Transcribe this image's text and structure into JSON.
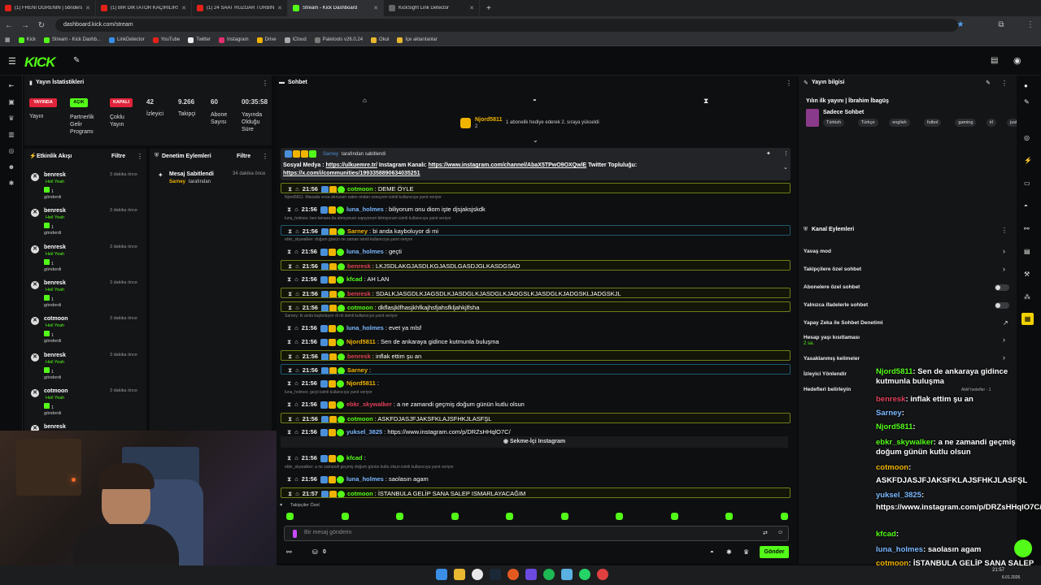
{
  "browser": {
    "tabs": [
      {
        "title": "(1) FRENİ ÖĞRENİN | 5briders",
        "color": "#e62117"
      },
      {
        "title": "(1) BİR DİKTATÖR KAÇIRILIRSA",
        "color": "#e62117"
      },
      {
        "title": "(1) 24 SAAT RÜZGAR TÜRBİNİ",
        "color": "#e62117"
      },
      {
        "title": "Stream - Kick Dashboard",
        "color": "#53fc18"
      },
      {
        "title": "KickSight Link Detector",
        "color": "#666666"
      }
    ],
    "url": "dashboard.kick.com/stream",
    "bookmarks": [
      "Kick",
      "Stream - Kick Dashb...",
      "LinkDetector",
      "YouTube",
      "Twitter",
      "Instagram",
      "Drive",
      "iCloud",
      "Paletools v26.0.24",
      "Okul",
      "İçe aktarılanlar"
    ]
  },
  "kick": {
    "logo": "KICK",
    "beta": "BETA"
  },
  "stats": {
    "title": "Yayın İstatistikleri",
    "badges": {
      "live": "YAYINDA",
      "open": "AÇIK",
      "closed": "KAPALI"
    },
    "labels": {
      "stream": "Yayın",
      "partner": "Partnerlik Gelir Programı",
      "multi": "Çoklu Yayın"
    },
    "viewers": "42",
    "viewers_label": "İzleyici",
    "followers": "9.266",
    "followers_label": "Takipçi",
    "subs": "60",
    "subs_label": "Abone Sayısı",
    "uptime": "00:35:58",
    "uptime_label": "Yayında Olduğu Süre"
  },
  "activity": {
    "title": "Etkinlik Akışı",
    "filter": "Filtre",
    "sub_text": "Heil Yeah",
    "count_text": "1",
    "count_label": "gönderdi",
    "items": [
      {
        "name": "benresk",
        "time": "3 dakika önce"
      },
      {
        "name": "benresk",
        "time": "3 dakika önce"
      },
      {
        "name": "benresk",
        "time": "3 dakika önce"
      },
      {
        "name": "benresk",
        "time": "3 dakika önce"
      },
      {
        "name": "cotmoon",
        "time": "3 dakika önce"
      },
      {
        "name": "benresk",
        "time": "3 dakika önce"
      },
      {
        "name": "cotmoon",
        "time": "3 dakika önce"
      },
      {
        "name": "benresk",
        "time": ""
      }
    ]
  },
  "moderation": {
    "title": "Denetim Eylemleri",
    "filter": "Filtre",
    "item_title": "Mesaj Sabitlendi",
    "item_time": "34 dakika önce",
    "item_user": "Sarney",
    "item_suffix": "tarafından"
  },
  "chat": {
    "title": "Sohbet",
    "gift_user": "Njord5811",
    "gift_count": "2",
    "gift_text": "1 abonelik hediye ederek 2. sıraya yükseldi",
    "pinned": {
      "by": "Sarney",
      "by_suffix": "tarafından sabitlendi",
      "line1_a": "Sosyal Medya : ",
      "link1": "https://ulkuemre.tr/",
      "line1_b": " Instagram Kanalı: ",
      "link2": "https://www.instagram.com/channel/AbaX5TPwO9OXQwlE",
      "line1_c": " Twitter Topluluğu:",
      "link3": "https://x.com/i/communities/1993358890634035251"
    },
    "messages": [
      {
        "kind": "hl",
        "time": "21:56",
        "user": "cotmoon",
        "color": "#53fc18",
        "text": "DEME ÖYLE"
      },
      {
        "kind": "reply",
        "text": "Njord5811: Masada vırsa atınızam zaten ondan sonuyom isimli kullanıcıya yanıt veriyor"
      },
      {
        "kind": "plain",
        "time": "21:56",
        "user": "luna_holmes",
        "color": "#7ab8ff",
        "text": "biliyorum onu diom işte djsjaksjskdk"
      },
      {
        "kind": "reply",
        "text": "luna_holmes: ben kenara da atmıyorum napıyorum bilmiyorum isimli kullanıcıya yanıt veriyor"
      },
      {
        "kind": "blue",
        "time": "21:56",
        "user": "Sarney",
        "color": "#f0b400",
        "text": "bi anda kayboluyor di mi"
      },
      {
        "kind": "reply",
        "text": "ebkr_skywalker: doğum günün ne zaman isimli kullanıcıya yanıt veriyor"
      },
      {
        "kind": "plain",
        "time": "21:56",
        "user": "luna_holmes",
        "color": "#7ab8ff",
        "text": "geçti"
      },
      {
        "kind": "hl",
        "time": "21:56",
        "user": "benresk",
        "color": "#e0405a",
        "text": "LKJSDLAKGJASDLKGJASDLGASDJGLKASDGSAD"
      },
      {
        "kind": "plain",
        "time": "21:56",
        "user": "kfcad",
        "color": "#53fc18",
        "text": "AH LAN"
      },
      {
        "kind": "hl",
        "time": "21:56",
        "user": "benresk",
        "color": "#e0405a",
        "text": "SDALKJASGDLKJAGSDLKJASDGLKJASDGLKJADGSLKJASDGLKJADGSKLJADGSKJL"
      },
      {
        "kind": "hl",
        "time": "21:56",
        "user": "cotmoon",
        "color": "#53fc18",
        "text": "dkflasjklfhasjkhfkajhsfjahsfkljahkjlfsha"
      },
      {
        "kind": "reply",
        "text": "Sarney: bi anda kayboluyor di mi isimli kullanıcıya yanıt veriyor"
      },
      {
        "kind": "plain",
        "time": "21:56",
        "user": "luna_holmes",
        "color": "#7ab8ff",
        "text": "evet ya mlsf"
      },
      {
        "kind": "plain",
        "time": "21:56",
        "user": "Njord5811",
        "color": "#f0b400",
        "text": "Sen de ankaraya gidince kutmunla buluşma"
      },
      {
        "kind": "hl",
        "time": "21:56",
        "user": "benresk",
        "color": "#e0405a",
        "text": "inflak ettim şu an"
      },
      {
        "kind": "blue",
        "time": "21:56",
        "user": "Sarney",
        "color": "#f0b400",
        "text": ""
      },
      {
        "kind": "plain",
        "time": "21:56",
        "user": "Njord5811",
        "color": "#f0b400",
        "text": ""
      },
      {
        "kind": "reply",
        "text": "luna_holmes: geçti isimli kullanıcıya yanıt veriyor"
      },
      {
        "kind": "plain",
        "time": "21:56",
        "user": "ebkr_skywalker",
        "color": "#e0405a",
        "text": "a ne zamandi geçmiş doğum günün kutlu olsun"
      },
      {
        "kind": "hl",
        "time": "21:56",
        "user": "cotmoon",
        "color": "#53fc18",
        "text": "ASKFDJASJFJAKSFKLAJSFHKJLASFŞL"
      },
      {
        "kind": "plain",
        "time": "21:56",
        "user": "yuksel_3825",
        "color": "#7ab8ff",
        "text": "https://www.instagram.com/p/DRZsHHqlO7C/"
      }
    ],
    "instagram_tab": "Sekme-İçi Instagram",
    "messages2": [
      {
        "kind": "plain",
        "time": "21:56",
        "user": "kfcad",
        "color": "#53fc18",
        "text": ""
      },
      {
        "kind": "reply",
        "text": "ebkr_skywalker: a ne zamandi geçmiş doğum günün kutlu olsun isimli kullanıcıya yanıt veriyor"
      },
      {
        "kind": "plain",
        "time": "21:56",
        "user": "luna_holmes",
        "color": "#7ab8ff",
        "text": "saolasın agam"
      },
      {
        "kind": "hl",
        "time": "21:57",
        "user": "cotmoon",
        "color": "#53fc18",
        "text": "İSTANBULA GELİP SANA SALEP ISMARLAYACAĞIM"
      }
    ],
    "followers_only": "Takipçiler Özel",
    "placeholder": "Bir mesaj gönderin",
    "send": "Gönder",
    "count": "0"
  },
  "info": {
    "title": "Yayın bilgisi",
    "stream_title": "Yılın ilk yayını | İbrahim İbagüş",
    "category": "Sadece Sohbet",
    "tags": [
      "Türkish",
      "Türkçe",
      "english",
      "futbol",
      "gaming",
      "irl",
      "justchatting"
    ]
  },
  "channel": {
    "title": "Kanal Eylemleri",
    "slow": "Yavaş mod",
    "followers_chat": "Takipçilere özel sohbet",
    "subs_chat": "Abonelere özel sohbet",
    "emotes_chat": "Yalnızca ifadelerle sohbet",
    "ai_mod": "Yapay Zeka ile Sohbet Denetimi",
    "age": "Hesap yaşı kısıtlaması",
    "age_val": "2 sa.",
    "banned": "Yasaklanmış kelimeler",
    "redirect": "İzleyici Yönlendir",
    "goals": "Hedefleri belirleyin",
    "goals_active": "Aktif hedefler · 1"
  },
  "overlay": [
    {
      "user": "Njord5811",
      "color": "#53fc18",
      "text": ": Sen de ankaraya gidince kutmunla buluşma"
    },
    {
      "user": "benresk",
      "color": "#e0405a",
      "text": ": inflak ettim şu an"
    },
    {
      "user": "Sarney",
      "color": "#7ab8ff",
      "text": ":"
    },
    {
      "user": "Njord5811",
      "color": "#53fc18",
      "text": ":"
    },
    {
      "user": "ebkr_skywalker",
      "color": "#53fc18",
      "text": ": a ne zamandi geçmiş doğum günün kutlu olsun"
    },
    {
      "user": "cotmoon",
      "color": "#f0b400",
      "text": ":"
    },
    {
      "user": "",
      "color": "#fff",
      "text": "ASKFDJASJFJAKSFKLAJSFHKJLASFŞL"
    },
    {
      "user": "yuksel_3825",
      "color": "#7ab8ff",
      "text": ":"
    },
    {
      "user": "",
      "color": "#fff",
      "text": "https://www.instagram.com/p/DRZsHHqlO7C/"
    },
    {
      "user": "kfcad",
      "color": "#53fc18",
      "text": ":"
    },
    {
      "user": "luna_holmes",
      "color": "#7ab8ff",
      "text": ": saolasın agam"
    },
    {
      "user": "cotmoon",
      "color": "#f0b400",
      "text": ": İSTANBULA GELİP SANA SALEP ISMARLAYACAĞIM"
    }
  ],
  "clock": {
    "time": "21:57",
    "date": "6.01.2026"
  },
  "colors": {
    "accent": "#53fc18",
    "live": "#e0243a"
  }
}
